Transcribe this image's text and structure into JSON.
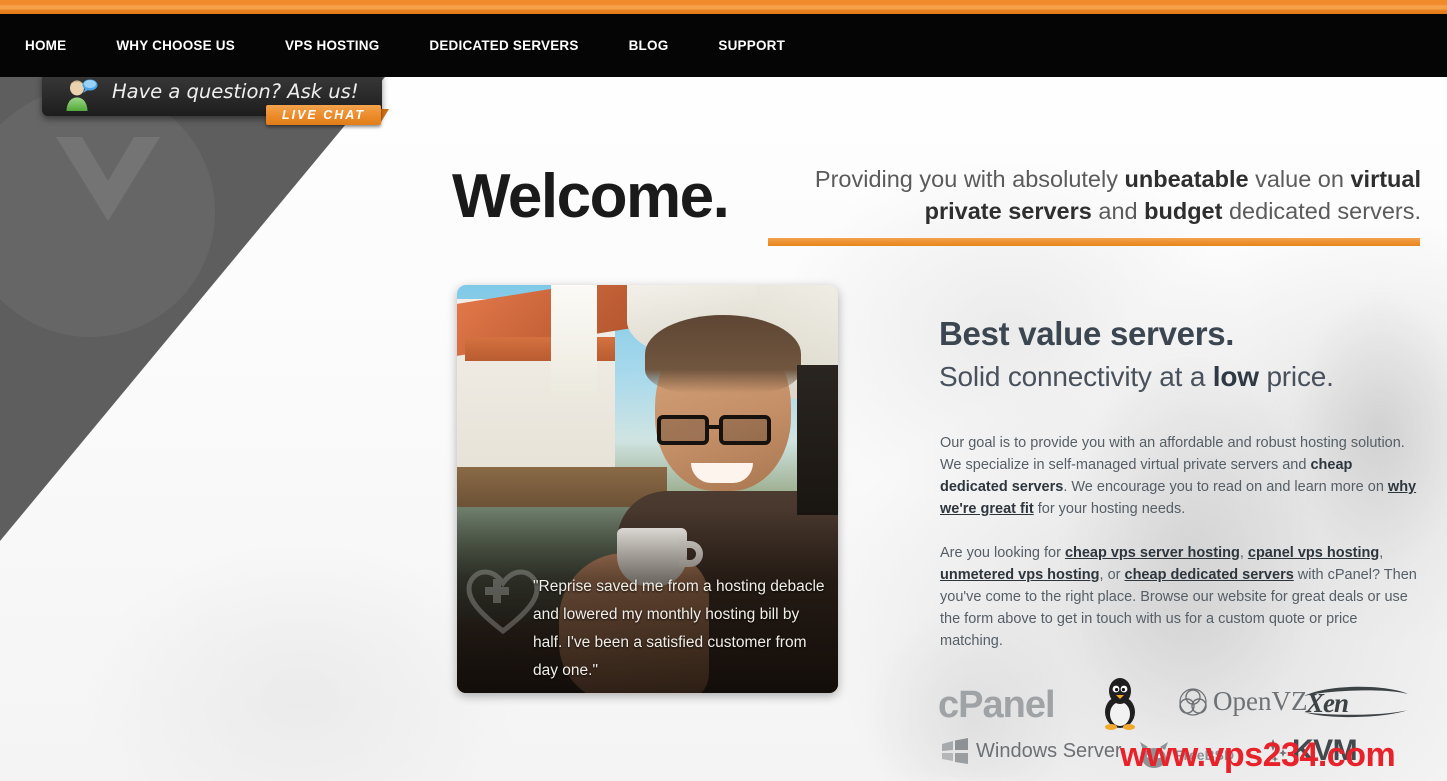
{
  "topbar": {
    "accent_color": "#f18a2b"
  },
  "nav": {
    "items": [
      {
        "label": "HOME",
        "name": "nav-home"
      },
      {
        "label": "WHY CHOOSE US",
        "name": "nav-why-choose-us"
      },
      {
        "label": "VPS HOSTING",
        "name": "nav-vps-hosting"
      },
      {
        "label": "DEDICATED SERVERS",
        "name": "nav-dedicated-servers"
      },
      {
        "label": "BLOG",
        "name": "nav-blog"
      },
      {
        "label": "SUPPORT",
        "name": "nav-support"
      }
    ]
  },
  "livechat": {
    "prompt": "Have a question? Ask us!",
    "button_label": "LIVE CHAT",
    "avatar_icon": "person-with-chat-bubble-icon",
    "button_color": "#ec8b2a"
  },
  "hero": {
    "heading": "Welcome.",
    "tagline_parts": [
      {
        "text": "Providing you with absolutely ",
        "bold": false
      },
      {
        "text": "unbeatable",
        "bold": true
      },
      {
        "text": " value on ",
        "bold": false
      },
      {
        "text": "virtual private servers",
        "bold": true
      },
      {
        "text": " and ",
        "bold": false
      },
      {
        "text": "budget",
        "bold": true
      },
      {
        "text": " dedicated servers.",
        "bold": false
      }
    ],
    "rule_color": "#ef9335"
  },
  "testimonial": {
    "quote": "\"Reprise saved me from a hosting debacle and lowered my monthly hosting bill by half. I've been a satisfied customer from day one.\"",
    "badge_icon": "heart-plus-icon",
    "photo_alt": "smiling man holding a coffee cup at an outdoor cafe"
  },
  "content": {
    "heading": "Best value servers.",
    "subheading_parts": [
      {
        "text": "Solid connectivity at a ",
        "bold": false
      },
      {
        "text": "low",
        "bold": true
      },
      {
        "text": " price.",
        "bold": false
      }
    ],
    "paragraph1_parts": [
      {
        "text": "Our goal is to provide you with an affordable and robust hosting solution. We specialize in self-managed virtual private servers and ",
        "style": "plain"
      },
      {
        "text": "cheap dedicated servers",
        "style": "bold"
      },
      {
        "text": ". We encourage you to read on and learn more on ",
        "style": "plain"
      },
      {
        "text": "why we're great fit",
        "style": "link"
      },
      {
        "text": " for your hosting needs.",
        "style": "plain"
      }
    ],
    "paragraph2_parts": [
      {
        "text": "Are you looking for ",
        "style": "plain"
      },
      {
        "text": "cheap vps server hosting",
        "style": "link"
      },
      {
        "text": ", ",
        "style": "plain"
      },
      {
        "text": "cpanel vps hosting",
        "style": "link"
      },
      {
        "text": ", ",
        "style": "plain"
      },
      {
        "text": "unmetered vps hosting",
        "style": "link"
      },
      {
        "text": ", or ",
        "style": "plain"
      },
      {
        "text": "cheap dedicated servers",
        "style": "link"
      },
      {
        "text": " with cPanel? Then you've come to the right place. Browse our website for great deals or use the form above to get in touch with us for a custom quote or price matching.",
        "style": "plain"
      }
    ]
  },
  "logos": {
    "cpanel": "cPanel",
    "linux": "linux-tux-penguin-icon",
    "openvz": "OpenVZ",
    "xen": "Xen",
    "windows_server": "Windows Server",
    "freebsd": "FreeBSD",
    "kvm": "KVM"
  },
  "watermark": {
    "text": "www.vps234.com",
    "color": "#e8222a"
  }
}
